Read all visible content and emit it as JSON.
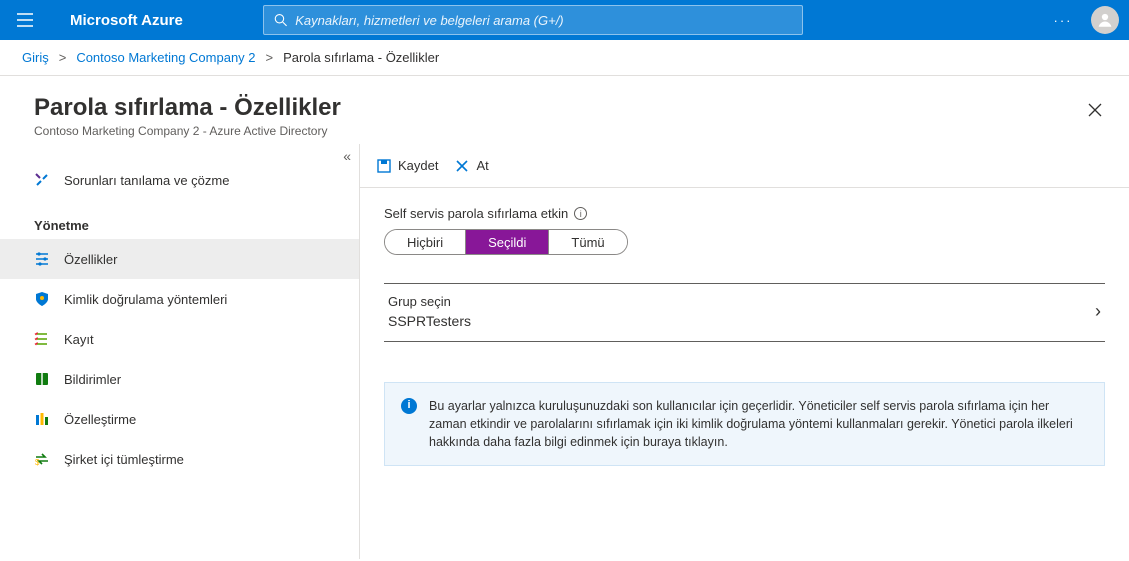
{
  "header": {
    "brand": "Microsoft Azure",
    "search_placeholder": "Kaynakları, hizmetleri ve belgeleri arama (G+/)",
    "more": "···"
  },
  "breadcrumb": {
    "home": "Giriş",
    "tenant": "Contoso Marketing Company 2",
    "current": "Parola sıfırlama - Özellikler"
  },
  "title": {
    "main": "Parola sıfırlama - Özellikler",
    "sub": "Contoso Marketing Company 2 - Azure Active Directory"
  },
  "sidebar": {
    "diagnose": "Sorunları tanılama ve çözme",
    "group_label": "Yönetme",
    "items": [
      {
        "label": "Özellikler"
      },
      {
        "label": "Kimlik doğrulama yöntemleri"
      },
      {
        "label": "Kayıt"
      },
      {
        "label": "Bildirimler"
      },
      {
        "label": "Özelleştirme"
      },
      {
        "label": "Şirket içi tümleştirme"
      }
    ]
  },
  "commands": {
    "save": "Kaydet",
    "discard": "At"
  },
  "main": {
    "sspr_label": "Self servis parola sıfırlama etkin",
    "options": {
      "none": "Hiçbiri",
      "selected": "Seçildi",
      "all": "Tümü"
    },
    "group_label": "Grup seçin",
    "group_value": "SSPRTesters",
    "info": "Bu ayarlar yalnızca kuruluşunuzdaki son kullanıcılar için geçerlidir. Yöneticiler self servis parola sıfırlama için her zaman etkindir ve parolalarını sıfırlamak için iki kimlik doğrulama yöntemi kullanmaları gerekir. Yönetici parola ilkeleri hakkında daha fazla bilgi edinmek için buraya tıklayın."
  }
}
